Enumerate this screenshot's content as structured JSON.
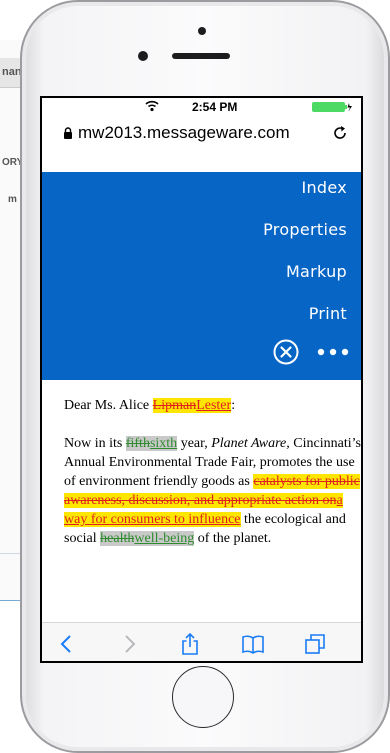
{
  "background": {
    "fragment_top": "nan",
    "fragment_mid": "ORY",
    "fragment_small": "m"
  },
  "status_bar": {
    "time": "2:54 PM"
  },
  "browser": {
    "url": "mw2013.messageware.com"
  },
  "menu": {
    "items": [
      "Index",
      "Properties",
      "Markup",
      "Print"
    ]
  },
  "document": {
    "greeting_prefix": "Dear Ms. Alice ",
    "name_deleted": "Lipman",
    "name_inserted": "Lester",
    "greeting_suffix": ":",
    "p_start": "Now in its ",
    "ordinal_deleted": "fifth",
    "ordinal_inserted": "sixth",
    "p_year": " year, ",
    "event_italic": "Planet Aware,",
    "p_mid": " Cincinnati’s Annual Environmental Trade Fair, promotes the use of environment friendly goods as ",
    "phrase_deleted": "catalysts for public awareness, discussion, and appropriate action on",
    "phrase_inserted": "a way for consumers to influence",
    "p_mid2": " the ecological and social ",
    "word_deleted": "health",
    "word_inserted": "well-being",
    "p_end": " of the planet."
  },
  "colors": {
    "menu_background": "#0765c6",
    "deletion": "#e02020",
    "highlight": "#ffe600",
    "format_change": "#2e8b2e"
  }
}
